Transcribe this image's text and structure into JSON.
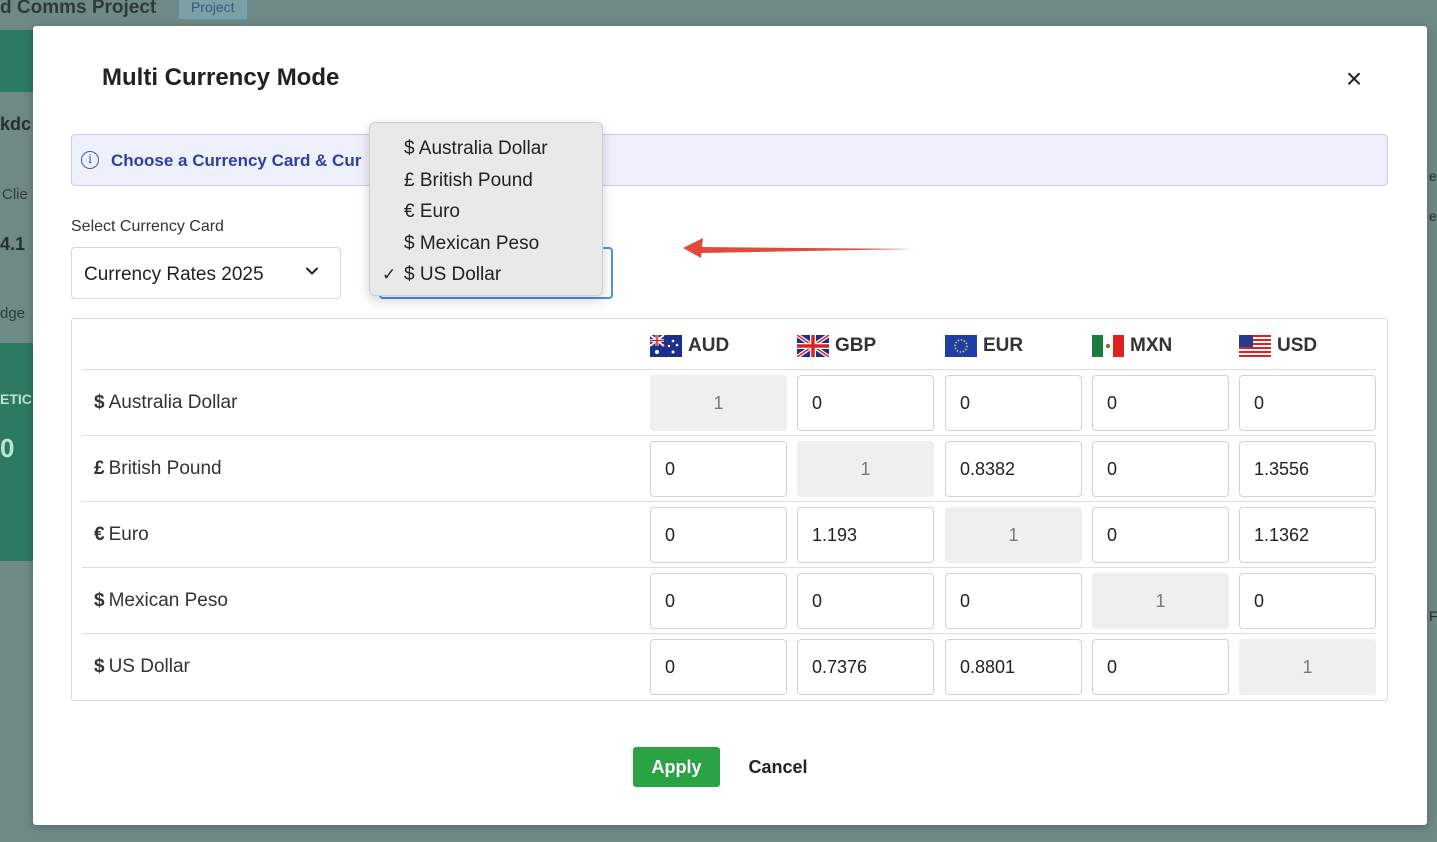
{
  "background": {
    "title": "d Comms Project",
    "badge": "Project",
    "fragments": [
      "kdc",
      "Clie",
      "4.1",
      "dge",
      "ETIC",
      "0",
      "e",
      "et",
      "Fo"
    ]
  },
  "modal": {
    "title": "Multi Currency Mode",
    "close_label": "×",
    "info_text": "Choose a Currency Card & Cur",
    "select_card_label": "Select Currency Card",
    "select_card_value": "Currency Rates 2025"
  },
  "dropdown": {
    "options": [
      {
        "label": "$ Australia Dollar",
        "selected": false
      },
      {
        "label": "£ British Pound",
        "selected": false
      },
      {
        "label": "€ Euro",
        "selected": false
      },
      {
        "label": "$ Mexican Peso",
        "selected": false
      },
      {
        "label": "$ US Dollar",
        "selected": true
      }
    ],
    "check_mark": "✓"
  },
  "table": {
    "columns": [
      {
        "code": "AUD",
        "flag": "australia-flag-icon"
      },
      {
        "code": "GBP",
        "flag": "uk-flag-icon"
      },
      {
        "code": "EUR",
        "flag": "eu-flag-icon"
      },
      {
        "code": "MXN",
        "flag": "mexico-flag-icon"
      },
      {
        "code": "USD",
        "flag": "us-flag-icon"
      }
    ],
    "rows": [
      {
        "symbol": "$",
        "name": "Australia Dollar",
        "values": [
          "1",
          "0",
          "0",
          "0",
          "0"
        ]
      },
      {
        "symbol": "£",
        "name": "British Pound",
        "values": [
          "0",
          "1",
          "0.8382",
          "0",
          "1.3556"
        ]
      },
      {
        "symbol": "€",
        "name": "Euro",
        "values": [
          "0",
          "1.193",
          "1",
          "0",
          "1.1362"
        ]
      },
      {
        "symbol": "$",
        "name": "Mexican Peso",
        "values": [
          "0",
          "0",
          "0",
          "1",
          "0"
        ]
      },
      {
        "symbol": "$",
        "name": "US Dollar",
        "values": [
          "0",
          "0.7376",
          "0.8801",
          "0",
          "1"
        ]
      }
    ]
  },
  "buttons": {
    "apply": "Apply",
    "cancel": "Cancel"
  },
  "colors": {
    "apply_bg": "#2aa344",
    "info_text": "#2f3fa6",
    "focus_border": "#4f8fe6",
    "arrow": "#e24a3b"
  }
}
